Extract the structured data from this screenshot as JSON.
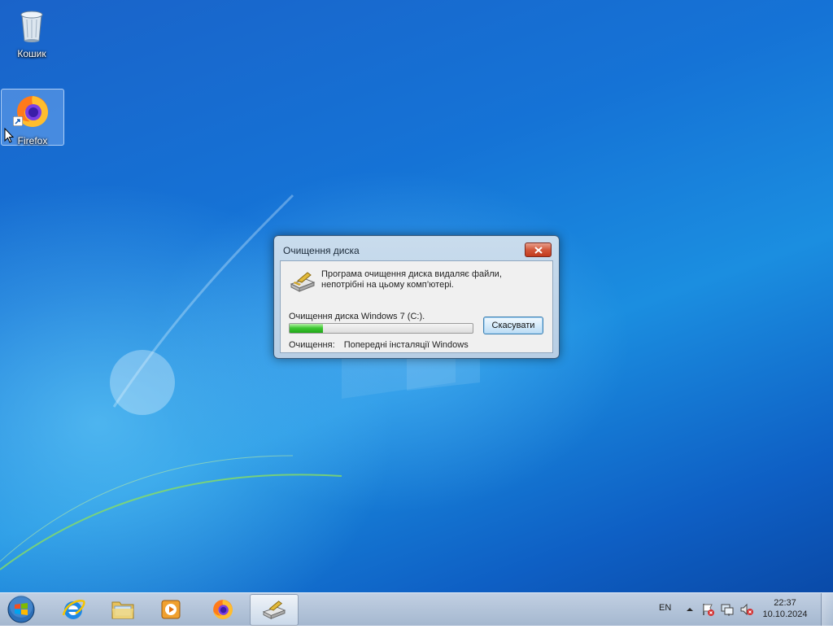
{
  "desktop": {
    "icons": [
      {
        "label": "Кошик",
        "icon": "recycle-bin-icon"
      },
      {
        "label": "Firefox",
        "icon": "firefox-icon"
      }
    ]
  },
  "dialog": {
    "title": "Очищення диска",
    "description_line1": "Програма очищення диска видаляє файли,",
    "description_line2": "непотрібні на цьому комп’ютері.",
    "status_label": "Очищення диска Windows 7 (C:).",
    "progress_percent": 18,
    "cancel_label": "Скасувати",
    "cleaning_label": "Очищення:",
    "cleaning_value": "Попередні інсталяції Windows"
  },
  "taskbar": {
    "pinned": [
      {
        "name": "internet-explorer",
        "icon": "internet-explorer-icon"
      },
      {
        "name": "windows-explorer",
        "icon": "folder-icon"
      },
      {
        "name": "media-player",
        "icon": "media-player-icon"
      },
      {
        "name": "firefox",
        "icon": "firefox-icon"
      },
      {
        "name": "disk-cleanup",
        "icon": "disk-cleanup-icon",
        "active": true
      }
    ],
    "language": "EN",
    "time": "22:37",
    "date": "10.10.2024"
  },
  "colors": {
    "desktop_blue": "#1573d6",
    "progress_green": "#3fc934",
    "close_red": "#c23a1c"
  }
}
